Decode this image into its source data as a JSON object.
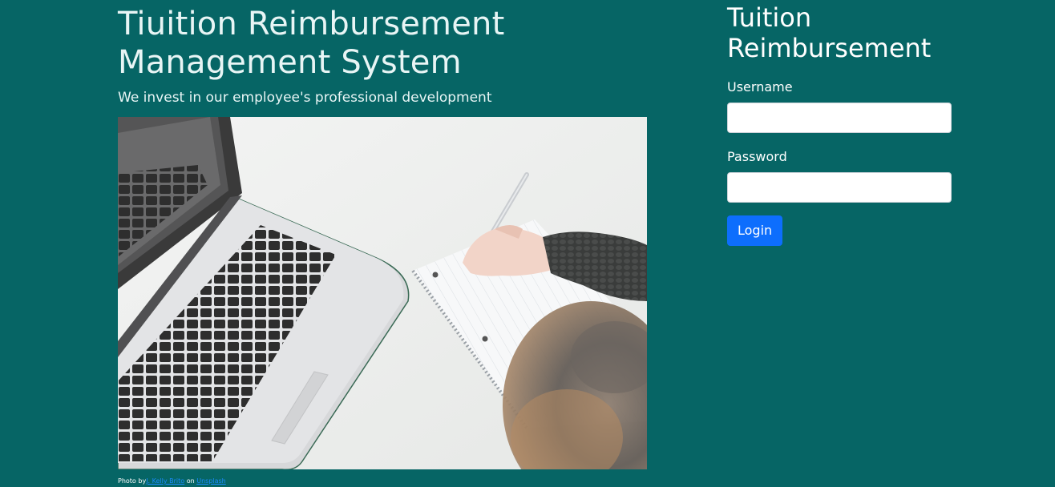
{
  "hero": {
    "title": "Tiuition Reimbursement Management System",
    "subtitle": "We invest in our employee's professional development",
    "photo_credit": {
      "prefix": "Photo by",
      "author": "J. Kelly Brito",
      "middle": "on",
      "site": "Unsplash"
    }
  },
  "login": {
    "title": "Tuition Reimbursement",
    "username_label": "Username",
    "username_value": "",
    "password_label": "Password",
    "password_value": "",
    "button_label": "Login"
  },
  "colors": {
    "background": "#066565",
    "button": "#0d6efd",
    "link": "#1a8cff"
  }
}
